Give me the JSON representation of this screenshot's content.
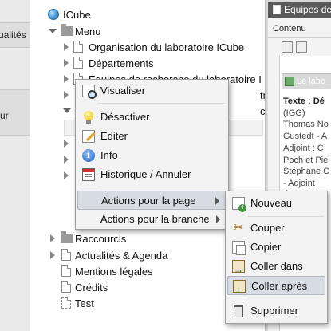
{
  "left_strip": {
    "items": [
      {
        "label": "ualités"
      },
      {
        "label": "ur"
      }
    ]
  },
  "tree": {
    "root": "ICube",
    "menu": "Menu",
    "items": [
      "Organisation du laboratoire ICube",
      "Départements",
      "Equipes de recherche du laboratoire I",
      "Plateformes et programmes transve",
      "Cellules et services transversaux officielles"
    ],
    "partial_items": [
      "transv",
      "cielles"
    ],
    "bottom_items": [
      "Raccourcis",
      "Actualités & Agenda",
      "Mentions légales",
      "Crédits",
      "Test"
    ]
  },
  "context_menu": {
    "items": [
      {
        "label": "Visualiser",
        "icon": "view-icon"
      },
      {
        "label": "Désactiver",
        "icon": "bulb-icon"
      },
      {
        "label": "Editer",
        "icon": "edit-icon"
      },
      {
        "label": "Info",
        "icon": "info-icon"
      },
      {
        "label": "Historique / Annuler",
        "icon": "history-icon"
      },
      {
        "label": "Actions pour la page",
        "submenu": true
      },
      {
        "label": "Actions pour la branche",
        "submenu": true
      }
    ]
  },
  "submenu": {
    "items": [
      {
        "label": "Nouveau",
        "icon": "new-page-icon"
      },
      {
        "label": "Couper",
        "icon": "scissors-icon"
      },
      {
        "label": "Copier",
        "icon": "copy-icon"
      },
      {
        "label": "Coller dans",
        "icon": "paste-into-icon"
      },
      {
        "label": "Coller après",
        "icon": "paste-after-icon"
      },
      {
        "label": "Supprimer",
        "icon": "trash-icon"
      }
    ]
  },
  "right_panel": {
    "header": "Equipes de",
    "contenu": "Contenu",
    "bar_title": "Le labo",
    "text_lines": [
      {
        "text": "Texte : Dé",
        "bold": true
      },
      {
        "text": "(IGG)"
      },
      {
        "text": "Thomas No"
      },
      {
        "text": "Gustedt - A"
      },
      {
        "text": "Adjoint : C"
      },
      {
        "text": "Poch et Pie"
      },
      {
        "text": "Stéphane C"
      },
      {
        "text": "  - Adjoint"
      },
      {
        "text": "Équipe Ima"
      },
      {
        "text": "Benoit Nae"
      }
    ]
  },
  "colors": {
    "menu_bg": "#f3f3f3",
    "highlight": "#d7dbe2",
    "panel_header": "#5a5a5a",
    "panel_bg": "#d8d8d8"
  }
}
